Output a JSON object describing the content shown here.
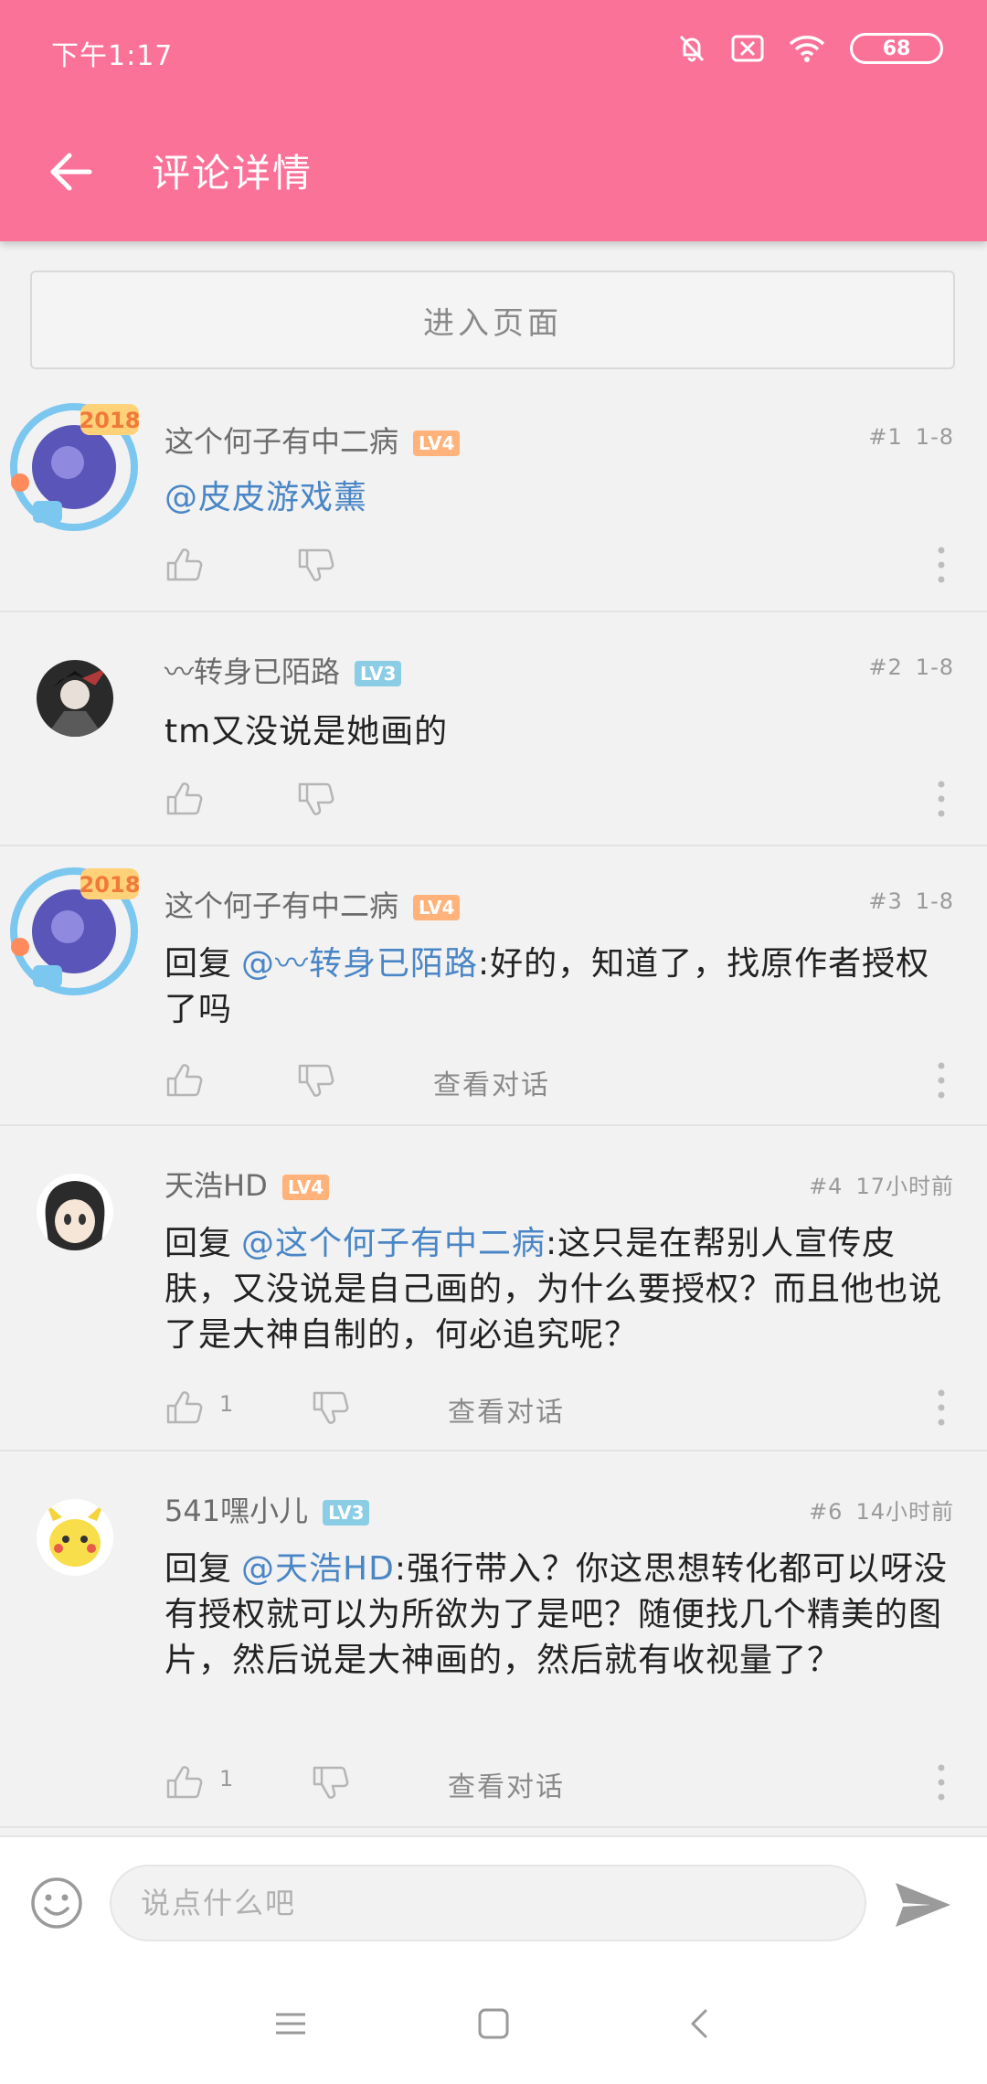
{
  "status_bar": {
    "time": "下午1:17",
    "battery": "68"
  },
  "header": {
    "title": "评论详情"
  },
  "enter_page_label": "进入页面",
  "comments": [
    {
      "username": "这个何子有中二病",
      "level": "LV4",
      "level_color": "#ffb27a",
      "floor": "#1",
      "time": "1-8",
      "mention": "@皮皮游戏薰",
      "text": "",
      "likes": "",
      "view_conversation": "",
      "avatar": "avatar-frame-2018"
    },
    {
      "username": "〰转身已陌路",
      "level": "LV3",
      "level_color": "#8ccde6",
      "floor": "#2",
      "time": "1-8",
      "mention": "",
      "text": "tm又没说是她画的",
      "likes": "",
      "view_conversation": "",
      "avatar": "avatar-anime-dark"
    },
    {
      "username": "这个何子有中二病",
      "level": "LV4",
      "level_color": "#ffb27a",
      "floor": "#3",
      "time": "1-8",
      "reply_prefix": "回复",
      "mention": "@〰转身已陌路",
      "text": ":好的，知道了，找原作者授权了吗",
      "likes": "",
      "view_conversation": "查看对话",
      "avatar": "avatar-frame-2018"
    },
    {
      "username": "天浩HD",
      "level": "LV4",
      "level_color": "#ffb27a",
      "floor": "#4",
      "time": "17小时前",
      "reply_prefix": "回复",
      "mention": "@这个何子有中二病",
      "text": ":这只是在帮别人宣传皮肤，又没说是自己画的，为什么要授权？而且他也说了是大神自制的，何必追究呢？",
      "likes": "1",
      "view_conversation": "查看对话",
      "avatar": "avatar-anime-girl"
    },
    {
      "username": "541嘿小儿",
      "level": "LV3",
      "level_color": "#8ccde6",
      "floor": "#6",
      "time": "14小时前",
      "reply_prefix": "回复",
      "mention": "@天浩HD",
      "text": ":强行带入？你这思想转化都可以呀没有授权就可以为所欲为了是吧？随便找几个精美的图片，然后说是大神画的，然后就有收视量了？",
      "likes": "1",
      "view_conversation": "查看对话",
      "avatar": "avatar-pikachu"
    }
  ],
  "input": {
    "placeholder": "说点什么吧"
  },
  "colors": {
    "accent": "#fb7299",
    "mention": "#4a86c6"
  }
}
